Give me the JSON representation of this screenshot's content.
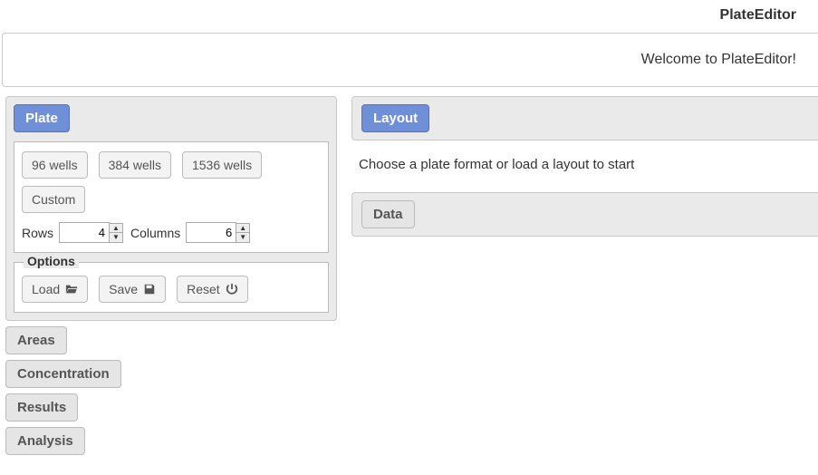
{
  "header": {
    "title": "PlateEditor"
  },
  "welcome": "Welcome to PlateEditor!",
  "left": {
    "active_tab": "Plate",
    "format_group": {
      "buttons": [
        "96 wells",
        "384 wells",
        "1536 wells",
        "Custom"
      ],
      "rows_label": "Rows",
      "rows_value": "4",
      "cols_label": "Columns",
      "cols_value": "6"
    },
    "options": {
      "legend": "Options",
      "load": "Load",
      "save": "Save",
      "reset": "Reset"
    },
    "inactive_tabs": [
      "Areas",
      "Concentration",
      "Results",
      "Analysis"
    ]
  },
  "right": {
    "layout_tab": "Layout",
    "message": "Choose a plate format or load a layout to start",
    "data_tab": "Data"
  }
}
